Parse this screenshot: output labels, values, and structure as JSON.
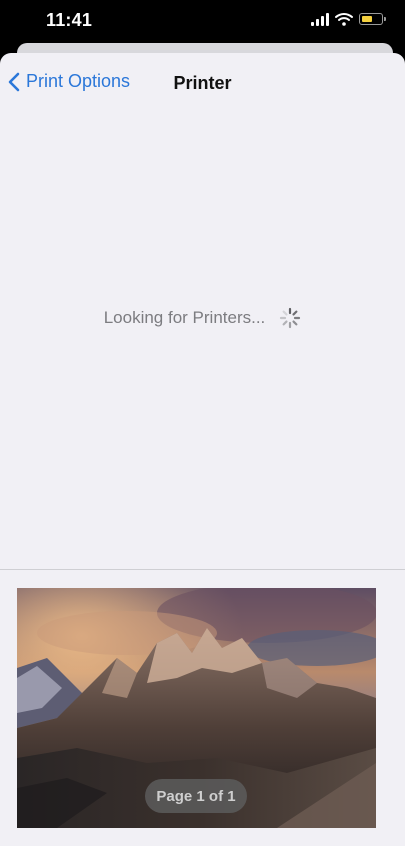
{
  "status_bar": {
    "time": "11:41",
    "icons": [
      "signal-icon",
      "wifi-icon",
      "battery-icon"
    ],
    "battery_level": 0.55
  },
  "nav": {
    "back_label": "Print Options",
    "title": "Printer"
  },
  "main": {
    "loading_text": "Looking for Printers..."
  },
  "preview": {
    "page_label": "Page 1 of 1"
  },
  "colors": {
    "accent": "#2b77d9",
    "sheet_background": "#f1f0f5",
    "battery_fill": "#f4d03f"
  }
}
